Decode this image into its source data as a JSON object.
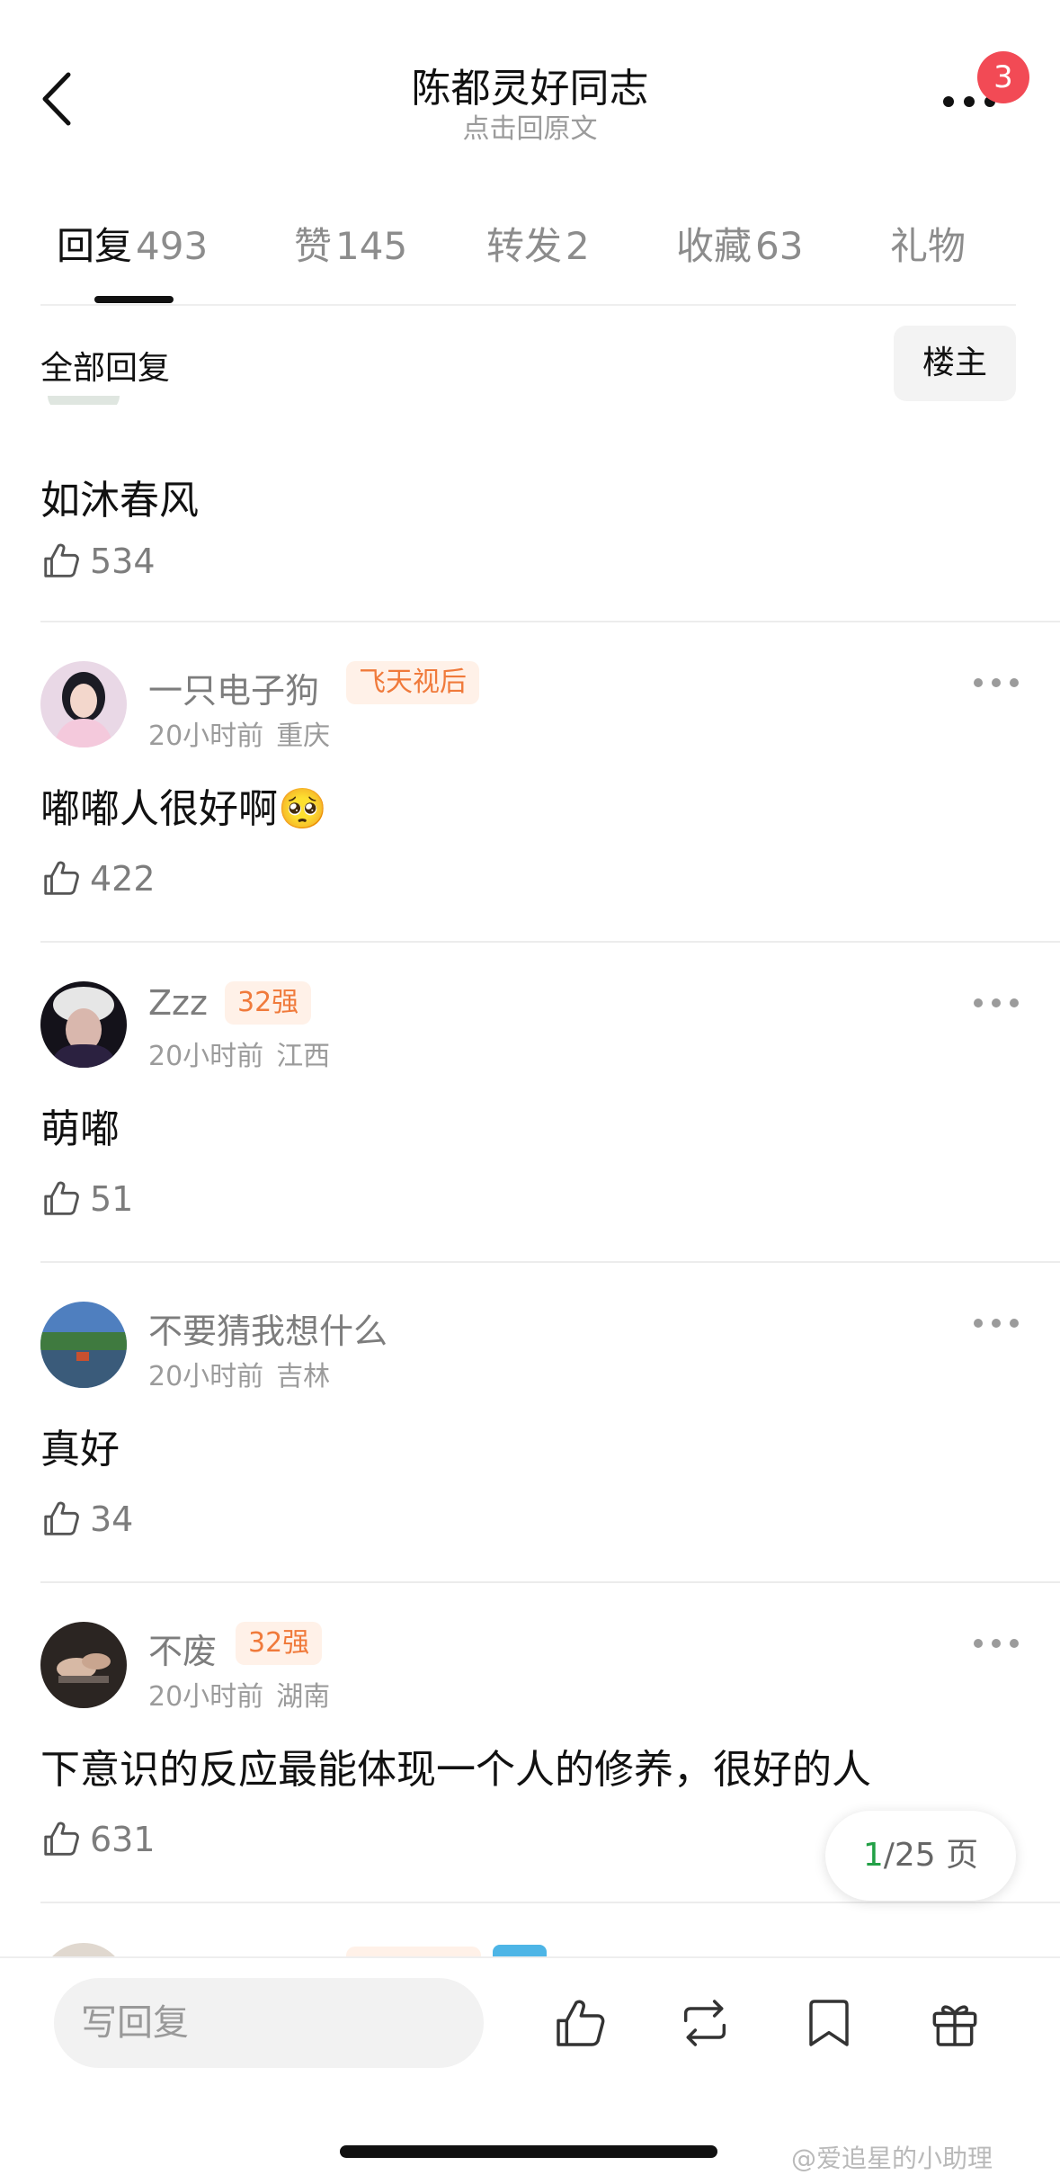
{
  "header": {
    "title": "陈都灵好同志",
    "subtitle": "点击回原文",
    "notification_count": "3"
  },
  "tabs": [
    {
      "label": "回复",
      "count": "493",
      "active": true
    },
    {
      "label": "赞",
      "count": "145",
      "active": false
    },
    {
      "label": "转发",
      "count": "2",
      "active": false
    },
    {
      "label": "收藏",
      "count": "63",
      "active": false
    },
    {
      "label": "礼物",
      "count": "",
      "active": false
    }
  ],
  "filter": {
    "title": "全部回复",
    "owner_button": "楼主"
  },
  "comments": [
    {
      "user": "",
      "tag": "",
      "time": "",
      "location": "",
      "text": "如沐春风",
      "likes": "534"
    },
    {
      "user": "一只电子狗",
      "tag": "飞天视后",
      "time": "20小时前",
      "location": "重庆",
      "text": "嘟嘟人很好啊🥺",
      "likes": "422"
    },
    {
      "user": "Zzz",
      "tag": "32强",
      "time": "20小时前",
      "location": "江西",
      "text": "萌嘟",
      "likes": "51"
    },
    {
      "user": "不要猜我想什么",
      "tag": "",
      "time": "20小时前",
      "location": "吉林",
      "text": "真好",
      "likes": "34"
    },
    {
      "user": "不废",
      "tag": "32强",
      "time": "20小时前",
      "location": "湖南",
      "text": "下意识的反应最能体现一个人的修养，很好的人",
      "likes": "631"
    }
  ],
  "pagination": {
    "current": "1",
    "total": "/25 页"
  },
  "bottom_bar": {
    "reply_placeholder": "写回复",
    "icons": [
      "like-icon",
      "repost-icon",
      "bookmark-icon",
      "gift-icon"
    ]
  },
  "watermark": "@爱追星的小助理",
  "colors": {
    "badge": "#f24a55",
    "tag_bg": "#fff1e8",
    "tag_text": "#f07a3b",
    "page_current": "#22a046"
  }
}
